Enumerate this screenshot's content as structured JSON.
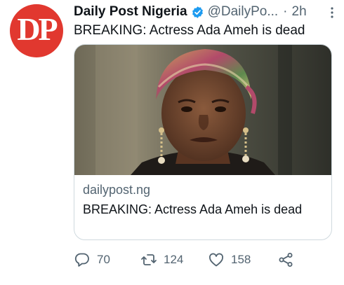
{
  "author": {
    "display_name": "Daily Post Nigeria",
    "handle": "@DailyPo...",
    "separator": "·",
    "time": "2h",
    "avatar_monogram": "DP",
    "verified": true
  },
  "tweet": {
    "text": "BREAKING: Actress Ada Ameh is dead"
  },
  "card": {
    "domain": "dailypost.ng",
    "title": "BREAKING: Actress Ada Ameh is dead"
  },
  "actions": {
    "reply_count": "70",
    "retweet_count": "124",
    "like_count": "158"
  },
  "colors": {
    "avatar_bg": "#e1382f",
    "verified": "#1d9bf0",
    "text_primary": "#0f1419",
    "text_secondary": "#536471",
    "card_border": "#cfd9de"
  },
  "icons": {
    "more": "more-dots-icon",
    "verified": "verified-badge-icon",
    "reply": "reply-icon",
    "retweet": "retweet-icon",
    "like": "heart-icon",
    "share": "share-icon"
  }
}
